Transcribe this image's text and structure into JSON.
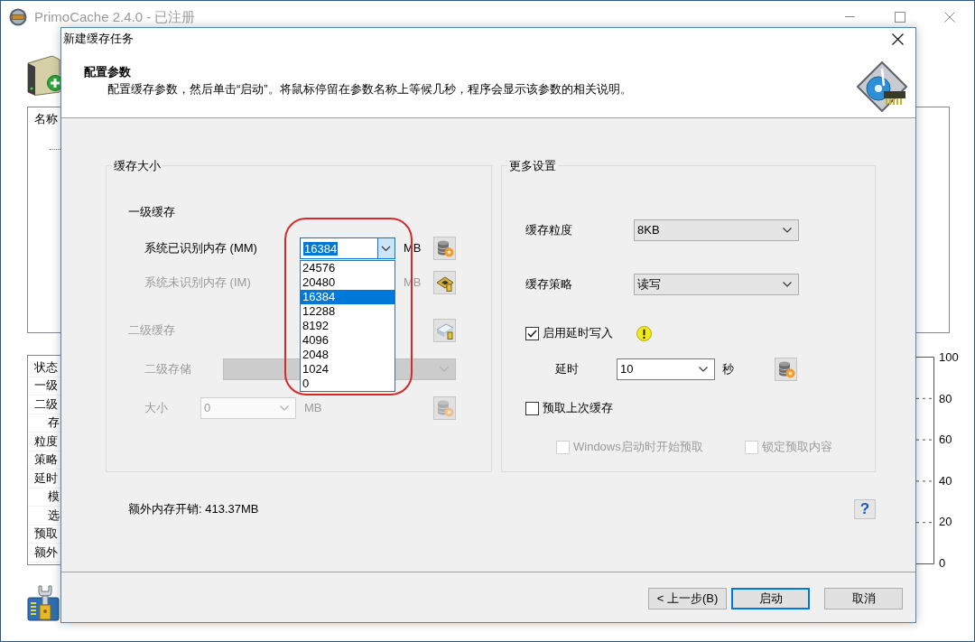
{
  "main_window": {
    "title": "PrimoCache 2.4.0 - 已注册",
    "task_list": {
      "column_1": "名称"
    },
    "details": {
      "rows": [
        {
          "label": "状态"
        },
        {
          "label": "一级"
        },
        {
          "label": "二级",
          "children": [
            {
              "label": "存"
            }
          ]
        },
        {
          "label": "粒度"
        },
        {
          "label": "策略"
        },
        {
          "label": "延时",
          "children": [
            {
              "label": "模"
            },
            {
              "label": "选"
            }
          ]
        },
        {
          "label": "预取"
        },
        {
          "label": "额外"
        }
      ]
    },
    "usage_chart": {
      "tick_labels": [
        "100",
        "80",
        "60",
        "40",
        "20",
        "0"
      ]
    }
  },
  "dialog": {
    "title": "新建缓存任务",
    "header": {
      "heading": "配置参数",
      "description": "配置缓存参数，然后单击“启动”。将鼠标停留在参数名称上等候几秒，程序会显示该参数的相关说明。"
    },
    "cache_size": {
      "title": "缓存大小",
      "level1": {
        "title": "一级缓存",
        "rows": [
          {
            "label": "系统已识别内存 (MM)",
            "value": "16384",
            "unit": "MB",
            "disabled": false,
            "expanded": true,
            "options": [
              {
                "label": "24576",
                "selected": false
              },
              {
                "label": "20480",
                "selected": false
              },
              {
                "label": "16384",
                "selected": true
              },
              {
                "label": "12288",
                "selected": false
              },
              {
                "label": "8192",
                "selected": false
              },
              {
                "label": "4096",
                "selected": false
              },
              {
                "label": "2048",
                "selected": false
              },
              {
                "label": "1024",
                "selected": false
              },
              {
                "label": "0",
                "selected": false
              }
            ]
          },
          {
            "label": "系统未识别内存 (IM)",
            "unit": "MB",
            "disabled": true,
            "expanded": false
          }
        ]
      },
      "level2": {
        "title": "二级缓存",
        "disabled": true,
        "storage": {
          "label": "二级存储"
        },
        "size": {
          "label": "大小",
          "value": "0",
          "unit": "MB"
        }
      }
    },
    "more_settings": {
      "title": "更多设置",
      "selects": [
        {
          "label": "缓存粒度",
          "value": "8KB"
        },
        {
          "label": "缓存策略",
          "value": "读写"
        }
      ],
      "defer_write": {
        "label": "启用延时写入",
        "checked": true,
        "latency": {
          "label": "延时",
          "value": "10",
          "unit": "秒"
        }
      },
      "prefetch": {
        "label": "预取上次缓存",
        "checked": false,
        "options": [
          {
            "label": "Windows启动时开始预取",
            "checked": false,
            "disabled": true
          },
          {
            "label": "锁定预取内容",
            "checked": false,
            "disabled": true
          }
        ]
      }
    },
    "overhead": "额外内存开销: 413.37MB",
    "help_button": "?",
    "buttons": [
      {
        "label": "< 上一步(B)",
        "default": false
      },
      {
        "label": "启动",
        "default": true
      },
      {
        "label": "取消",
        "default": false
      }
    ]
  }
}
